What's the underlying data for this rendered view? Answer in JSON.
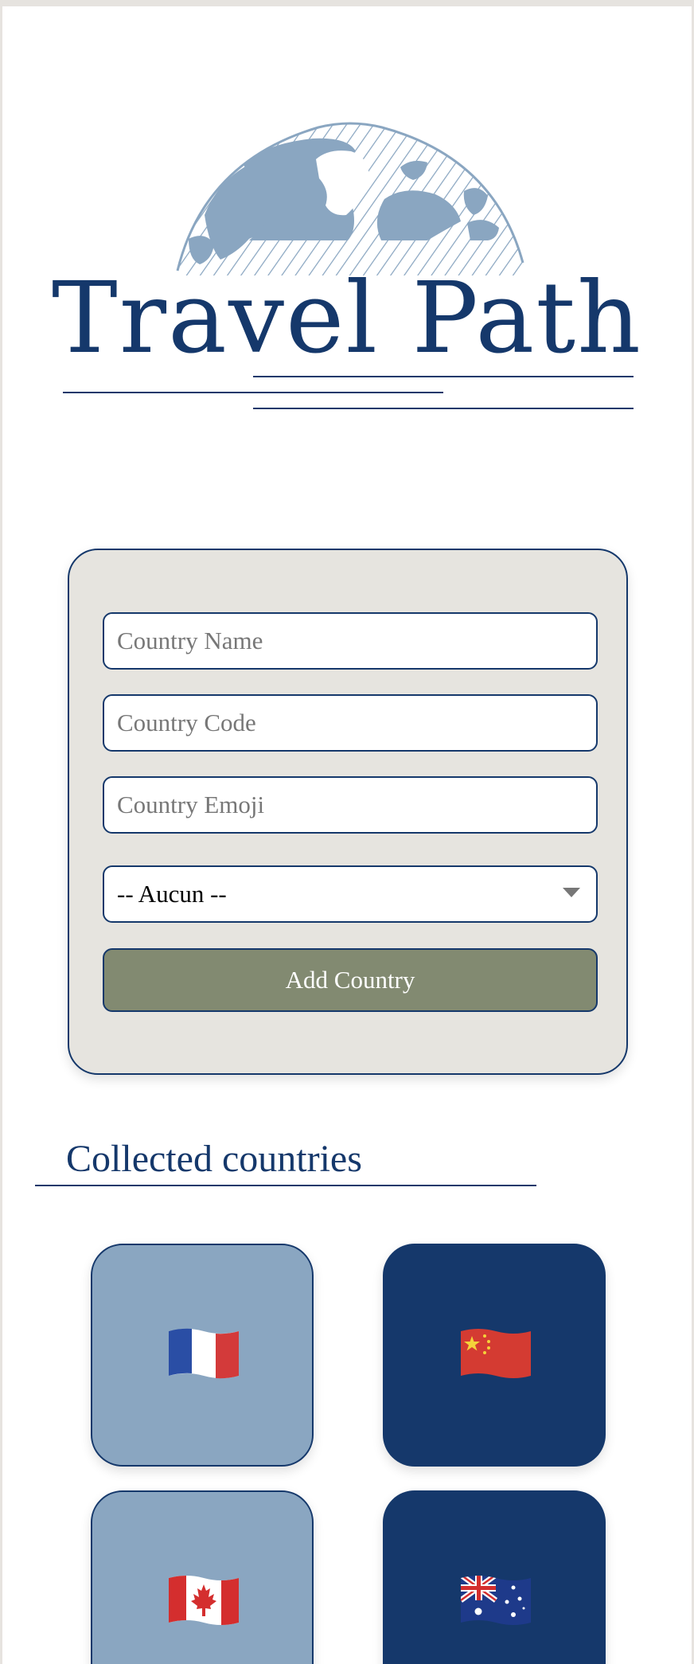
{
  "header": {
    "title": "Travel Path",
    "logo_icon": "globe-icon"
  },
  "form": {
    "country_name_placeholder": "Country Name",
    "country_code_placeholder": "Country Code",
    "country_emoji_placeholder": "Country Emoji",
    "select_value": "-- Aucun --",
    "add_button_label": "Add Country"
  },
  "collected": {
    "title": "Collected countries",
    "countries": [
      {
        "flag_icon": "france-flag-icon",
        "card_color": "#8aa6c1"
      },
      {
        "flag_icon": "china-flag-icon",
        "card_color": "#15386b"
      },
      {
        "flag_icon": "canada-flag-icon",
        "card_color": "#8aa6c1"
      },
      {
        "flag_icon": "australia-flag-icon",
        "card_color": "#15386b"
      }
    ]
  },
  "colors": {
    "primary_navy": "#15386b",
    "light_blue": "#8aa6c1",
    "button_olive": "#828a71",
    "card_background": "#e6e4df"
  }
}
